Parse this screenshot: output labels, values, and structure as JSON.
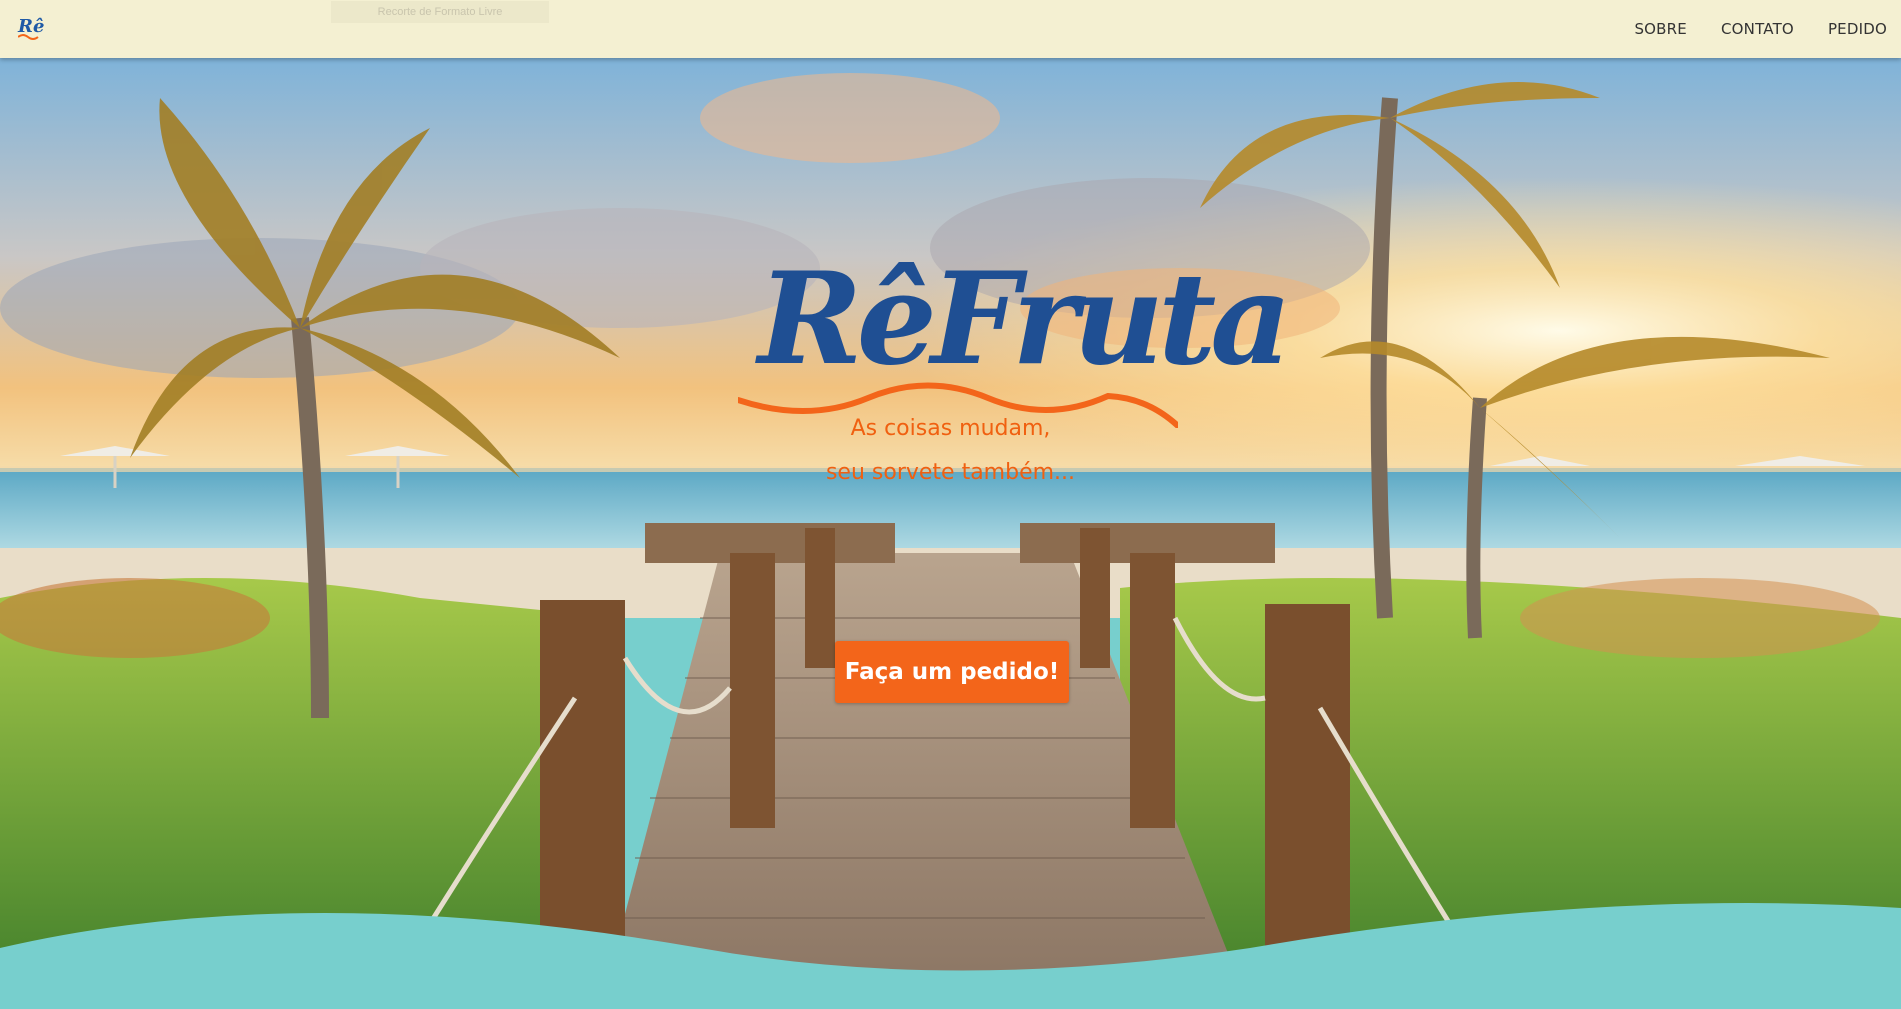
{
  "nav": {
    "logo_text": "Rê",
    "crop_tooltip": "Recorte de Formato Livre",
    "links": [
      "SOBRE",
      "CONTATO",
      "PEDIDO"
    ]
  },
  "hero": {
    "brand": "RêFruta",
    "tagline_line1": "As coisas mudam,",
    "tagline_line2": "seu sorvete também...",
    "cta_label": "Faça um pedido!"
  },
  "colors": {
    "navbar_bg": "#f4f0d2",
    "brand_blue": "#1f4f93",
    "accent_orange": "#f3651a",
    "wave_teal": "#77cfcd"
  }
}
